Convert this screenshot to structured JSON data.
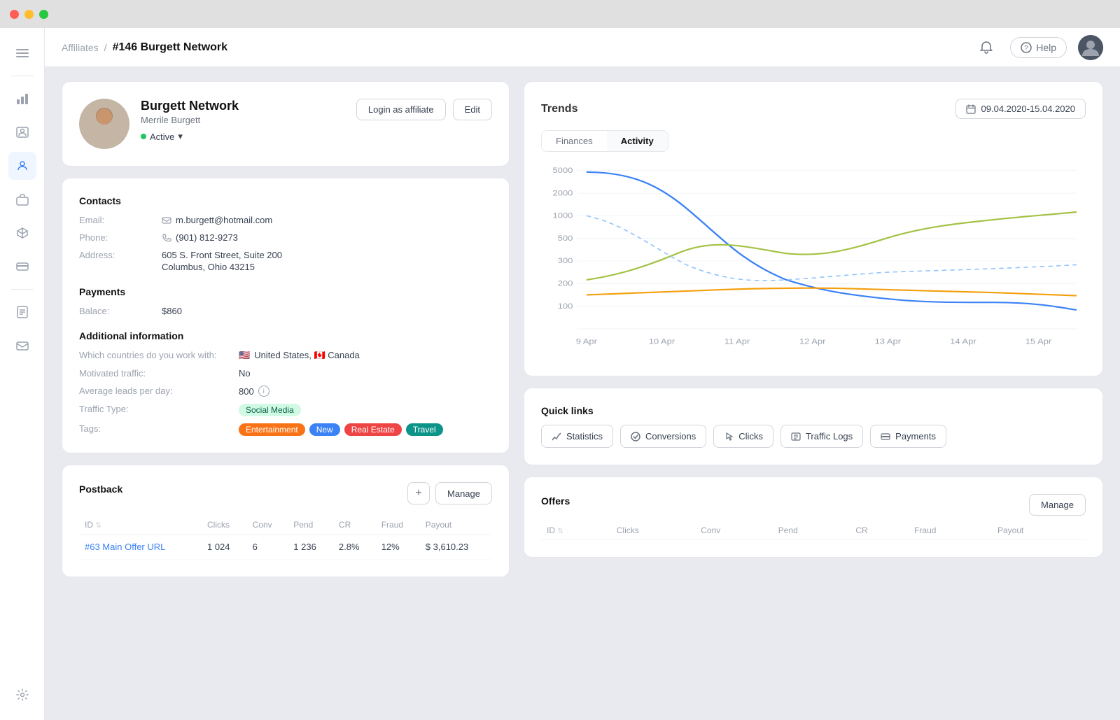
{
  "titlebar": {
    "dots": [
      "red",
      "yellow",
      "green"
    ]
  },
  "topnav": {
    "breadcrumb_link": "Affiliates",
    "breadcrumb_sep": "/",
    "breadcrumb_current": "#146 Burgett Network",
    "help_label": "Help",
    "notification_icon": "🔔"
  },
  "sidebar": {
    "items": [
      {
        "name": "menu",
        "icon": "☰",
        "active": false
      },
      {
        "name": "chart",
        "icon": "📊",
        "active": false
      },
      {
        "name": "contacts",
        "icon": "🪪",
        "active": false
      },
      {
        "name": "affiliates",
        "icon": "👤",
        "active": true
      },
      {
        "name": "briefcase",
        "icon": "💼",
        "active": false
      },
      {
        "name": "cube",
        "icon": "📦",
        "active": false
      },
      {
        "name": "card",
        "icon": "💳",
        "active": false
      },
      {
        "name": "report",
        "icon": "📋",
        "active": false
      },
      {
        "name": "mail",
        "icon": "✉️",
        "active": false
      },
      {
        "name": "settings",
        "icon": "⚙️",
        "active": false
      }
    ]
  },
  "profile": {
    "name": "Burgett Network",
    "sub_name": "Merrile Burgett",
    "status": "Active",
    "login_btn": "Login as affiliate",
    "edit_btn": "Edit"
  },
  "contacts": {
    "title": "Contacts",
    "email_label": "Email:",
    "email_value": "m.burgett@hotmail.com",
    "phone_label": "Phone:",
    "phone_value": "(901) 812-9273",
    "address_label": "Address:",
    "address_line1": "605 S. Front Street, Suite 200",
    "address_line2": "Columbus, Ohio 43215"
  },
  "payments": {
    "title": "Payments",
    "balance_label": "Balace:",
    "balance_value": "$860"
  },
  "additional": {
    "title": "Additional information",
    "countries_label": "Which countries do you work with:",
    "countries_value": "United States, 🇨🇦 Canada",
    "motivated_label": "Motivated traffic:",
    "motivated_value": "No",
    "avg_leads_label": "Average leads per day:",
    "avg_leads_value": "800",
    "traffic_type_label": "Traffic Type:",
    "traffic_type_value": "Social Media",
    "tags_label": "Tags:",
    "tags": [
      {
        "label": "Entertainment",
        "color": "orange"
      },
      {
        "label": "New",
        "color": "blue"
      },
      {
        "label": "Real Estate",
        "color": "red"
      },
      {
        "label": "Travel",
        "color": "teal"
      }
    ]
  },
  "postback": {
    "title": "Postback",
    "add_btn": "+",
    "manage_btn": "Manage",
    "columns": [
      "ID",
      "Clicks",
      "Conv",
      "Pend",
      "CR",
      "Fraud",
      "Payout"
    ],
    "rows": [
      {
        "id": "#63 Main Offer URL",
        "clicks": "1 024",
        "conv": "6",
        "pend": "1 236",
        "cr": "2.8%",
        "fraud": "12%",
        "payout": "$ 3,610.23"
      }
    ]
  },
  "trends": {
    "title": "Trends",
    "date_range": "09.04.2020-15.04.2020",
    "tabs": [
      "Finances",
      "Activity"
    ],
    "active_tab": "Activity",
    "y_labels": [
      "5000",
      "2000",
      "1000",
      "500",
      "300",
      "200",
      "100"
    ],
    "x_labels": [
      "9 Apr",
      "10 Apr",
      "11 Apr",
      "12 Apr",
      "13 Apr",
      "14 Apr",
      "15 Apr"
    ]
  },
  "quick_links": {
    "title": "Quick links",
    "links": [
      {
        "name": "Statistics",
        "icon": "chart"
      },
      {
        "name": "Conversions",
        "icon": "check"
      },
      {
        "name": "Clicks",
        "icon": "cursor"
      },
      {
        "name": "Traffic Logs",
        "icon": "list"
      },
      {
        "name": "Payments",
        "icon": "card"
      }
    ]
  },
  "offers": {
    "title": "Offers",
    "manage_btn": "Manage",
    "columns": [
      "ID",
      "Clicks",
      "Conv",
      "Pend",
      "CR",
      "Fraud",
      "Payout"
    ]
  }
}
